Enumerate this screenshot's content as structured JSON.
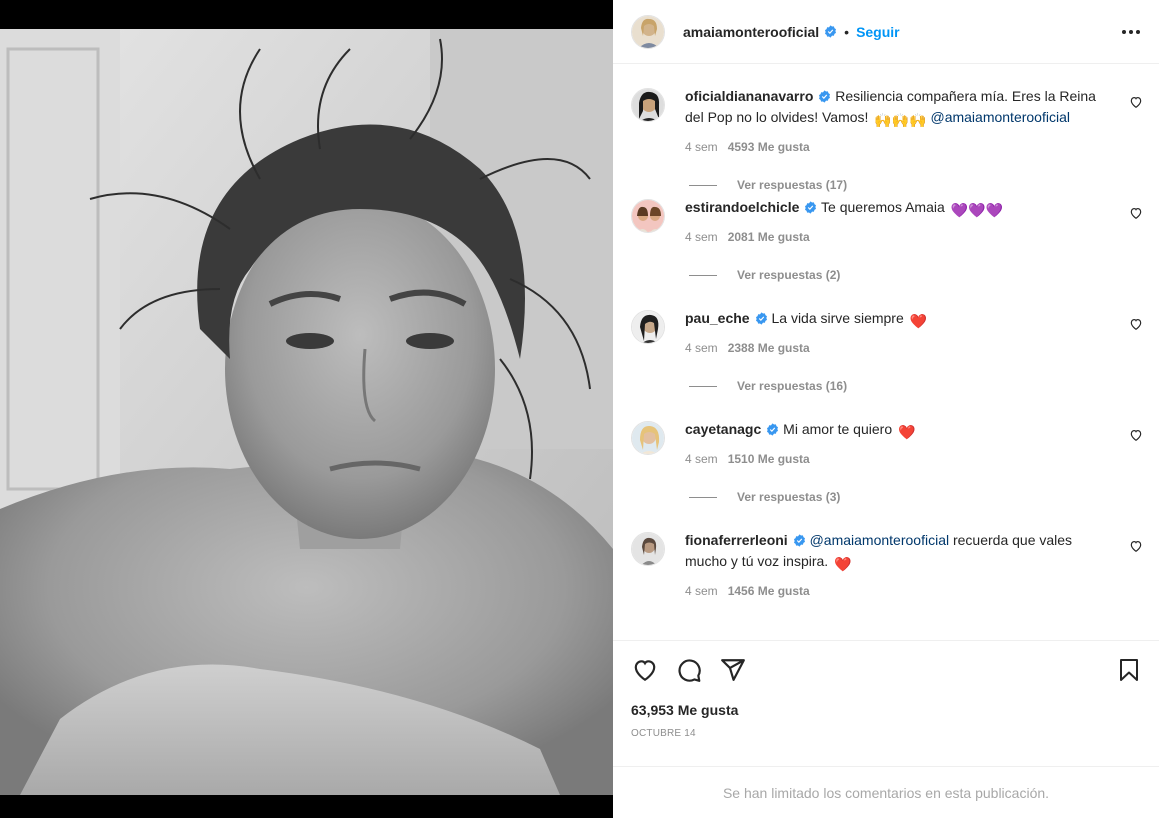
{
  "header": {
    "username": "amaiamonterooficial",
    "dot": "•",
    "follow_label": "Seguir",
    "more_icon": "more-horizontal-icon"
  },
  "comments": [
    {
      "username": "oficialdiananavarro",
      "verified": true,
      "text": "Resiliencia compañera mía. Eres la Reina del Pop no lo olvides! Vamos!",
      "emoji": "🙌🙌🙌",
      "mention": "@amaiamonterooficial",
      "age": "4 sem",
      "likes": "4593 Me gusta",
      "replies": "Ver respuestas (17)"
    },
    {
      "username": "estirandoelchicle",
      "verified": true,
      "text": "Te queremos Amaia",
      "emoji": "💜💜💜",
      "age": "4 sem",
      "likes": "2081 Me gusta",
      "replies": "Ver respuestas (2)"
    },
    {
      "username": "pau_eche",
      "verified": true,
      "text": "La vida sirve siempre",
      "emoji": "❤️",
      "age": "4 sem",
      "likes": "2388 Me gusta",
      "replies": "Ver respuestas (16)"
    },
    {
      "username": "cayetanagc",
      "verified": true,
      "text": "Mi amor te quiero",
      "emoji": "❤️",
      "age": "4 sem",
      "likes": "1510 Me gusta",
      "replies": "Ver respuestas (3)"
    },
    {
      "username": "fionaferrerleoni",
      "verified": true,
      "mention": "@amaiamonterooficial",
      "text": "recuerda que vales mucho y tú voz inspira.",
      "emoji": "❤️",
      "age": "4 sem",
      "likes": "1456 Me gusta"
    }
  ],
  "actions": {
    "like_icon": "heart-icon",
    "comment_icon": "comment-icon",
    "share_icon": "share-icon",
    "save_icon": "bookmark-icon",
    "likes_count": "63,953 Me gusta",
    "date": "OCTUBRE 14"
  },
  "footer": {
    "notice": "Se han limitado los comentarios en esta publicación."
  },
  "colors": {
    "link_blue": "#0095f6",
    "mention_blue": "#00376b",
    "verified_blue": "#3897f0",
    "muted": "#8e8e8e",
    "heart_red": "#ed1c24",
    "purple_heart": "#8c52ff"
  }
}
